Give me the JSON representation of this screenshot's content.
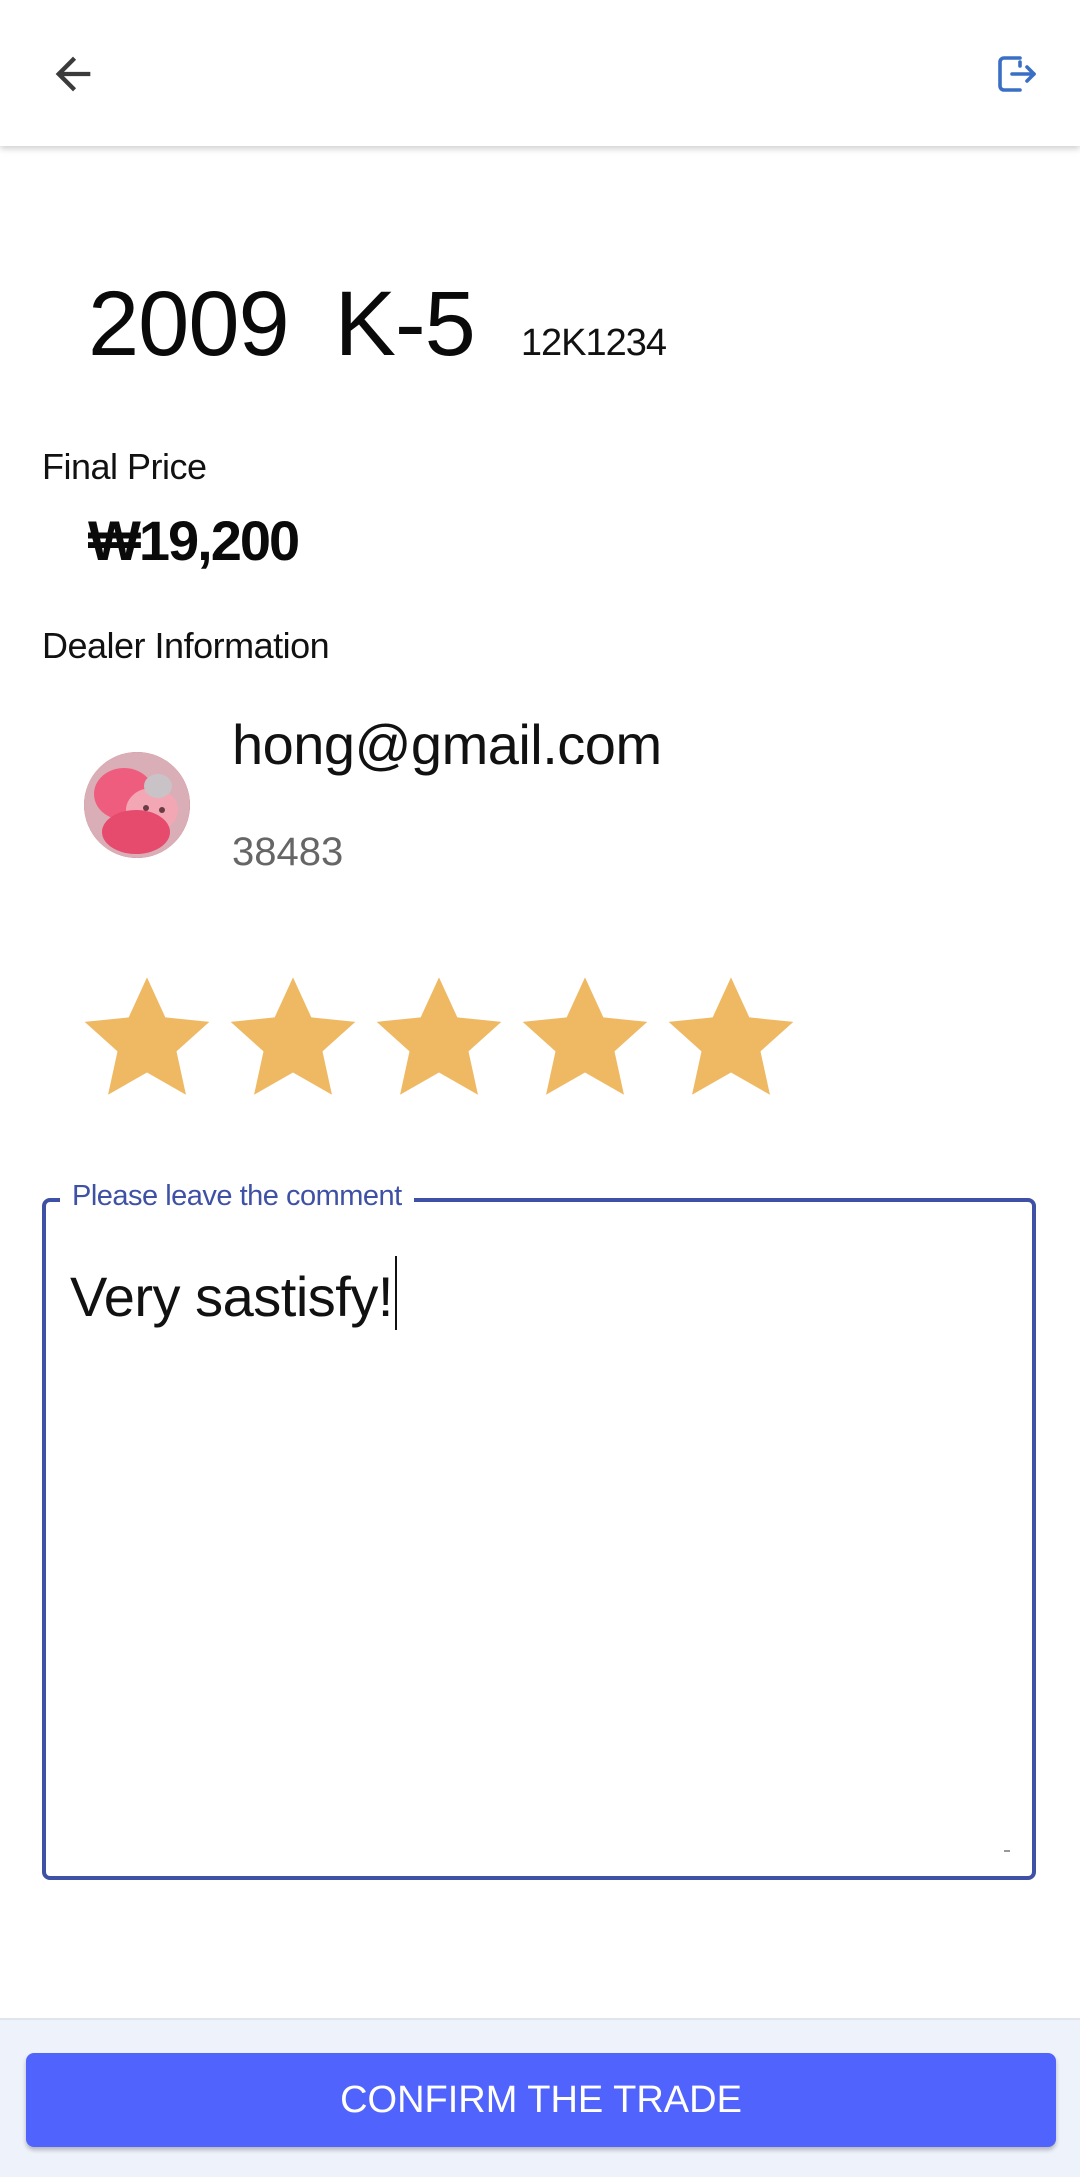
{
  "header": {
    "back_icon": "arrow-left-icon",
    "logout_icon": "logout-icon",
    "accent_color": "#3a6fc4"
  },
  "car": {
    "year": "2009",
    "model": "K-5",
    "plate": "12K1234"
  },
  "price": {
    "label": "Final Price",
    "value": "₩19,200"
  },
  "dealer": {
    "label": "Dealer Information",
    "email": "hong@gmail.com",
    "id": "38483",
    "avatar_icon": "avatar-image"
  },
  "rating": {
    "value": 5,
    "max": 5,
    "star_color": "#efb963"
  },
  "comment": {
    "label": "Please leave the comment",
    "value": "Very sastisfy!",
    "border_color": "#3f51a5"
  },
  "footer": {
    "confirm_label": "CONFIRM THE TRADE",
    "button_color": "#5163fd"
  }
}
